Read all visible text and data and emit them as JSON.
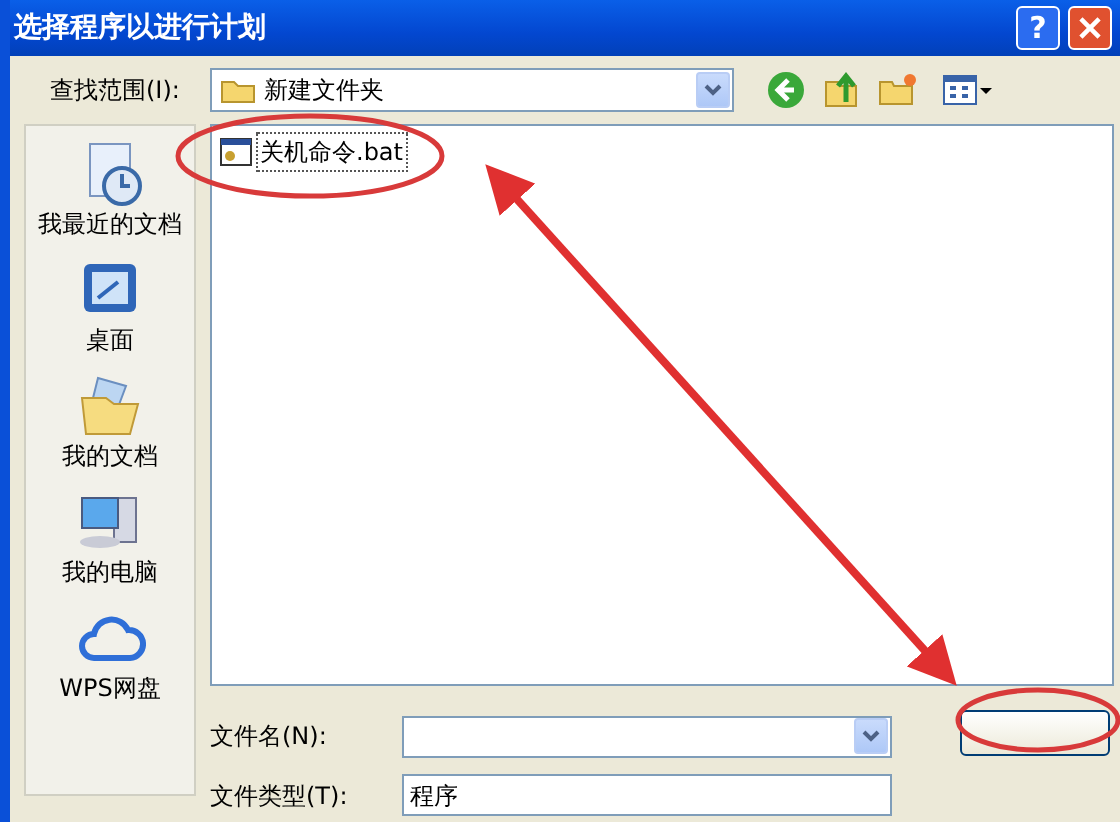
{
  "window": {
    "title": "选择程序以进行计划",
    "help_button": "?"
  },
  "look_in": {
    "label": "查找范围(I):",
    "value": "新建文件夹"
  },
  "places": [
    {
      "label": "我最近的文档",
      "kind": "recent"
    },
    {
      "label": "桌面",
      "kind": "desktop"
    },
    {
      "label": "我的文档",
      "kind": "documents"
    },
    {
      "label": "我的电脑",
      "kind": "computer"
    },
    {
      "label": "WPS网盘",
      "kind": "cloud"
    }
  ],
  "files": [
    {
      "name": "关机命令.bat",
      "selected": true
    }
  ],
  "file_name": {
    "label": "文件名(N):"
  },
  "file_type": {
    "label": "文件类型(T):",
    "value": "程序"
  }
}
